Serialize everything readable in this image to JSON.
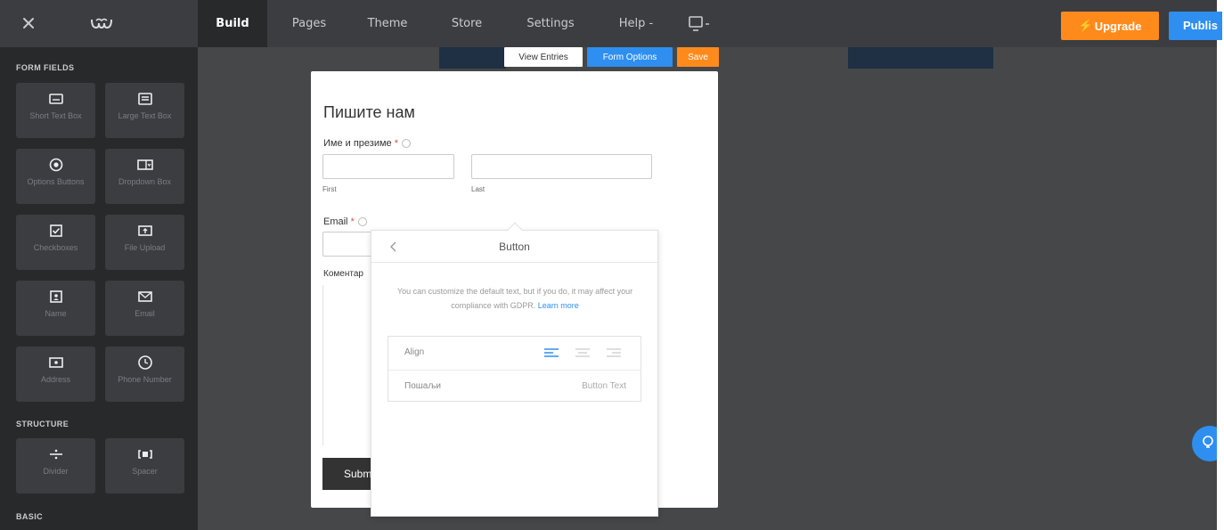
{
  "topbar": {
    "tabs": [
      {
        "label": "Build",
        "active": true
      },
      {
        "label": "Pages",
        "active": false
      },
      {
        "label": "Theme",
        "active": false
      },
      {
        "label": "Store",
        "active": false
      },
      {
        "label": "Settings",
        "active": false
      },
      {
        "label": "Help",
        "active": false
      }
    ],
    "upgrade_label": "Upgrade",
    "publish_label": "Publis"
  },
  "sidebar": {
    "section_form_fields": "FORM FIELDS",
    "section_structure": "STRUCTURE",
    "section_basic": "BASIC",
    "form_fields": [
      {
        "label": "Short Text Box",
        "icon": "short-text-box-icon"
      },
      {
        "label": "Large Text Box",
        "icon": "large-text-box-icon"
      },
      {
        "label": "Options Buttons",
        "icon": "radio-option-icon"
      },
      {
        "label": "Dropdown Box",
        "icon": "dropdown-box-icon"
      },
      {
        "label": "Checkboxes",
        "icon": "checkbox-icon"
      },
      {
        "label": "File Upload",
        "icon": "file-upload-icon"
      },
      {
        "label": "Name",
        "icon": "name-card-icon"
      },
      {
        "label": "Email",
        "icon": "envelope-icon"
      },
      {
        "label": "Address",
        "icon": "address-icon"
      },
      {
        "label": "Phone Number",
        "icon": "phone-icon"
      }
    ],
    "structure": [
      {
        "label": "Divider",
        "icon": "divider-icon"
      },
      {
        "label": "Spacer",
        "icon": "spacer-icon"
      }
    ]
  },
  "toolbar": {
    "view_entries": "View Entries",
    "form_options": "Form Options",
    "save": "Save"
  },
  "form": {
    "title": "Пишите нам",
    "name_label": "Име и презиме",
    "first_sub": "First",
    "last_sub": "Last",
    "email_label": "Email",
    "comment_label": "Коментар",
    "submit_label": "Submit"
  },
  "popover": {
    "title": "Button",
    "notice": "You can customize the default text, but if you do, it may affect your compliance with GDPR.",
    "learn_more": "Learn more",
    "align_label": "Align",
    "button_text_value": "Пошаљи",
    "button_text_label": "Button Text"
  },
  "colors": {
    "topbar": "#3b3d40",
    "sidebar": "#27292b",
    "canvas": "#454749",
    "accent_blue": "#2e8ff0",
    "accent_orange": "#ff8a1c"
  }
}
